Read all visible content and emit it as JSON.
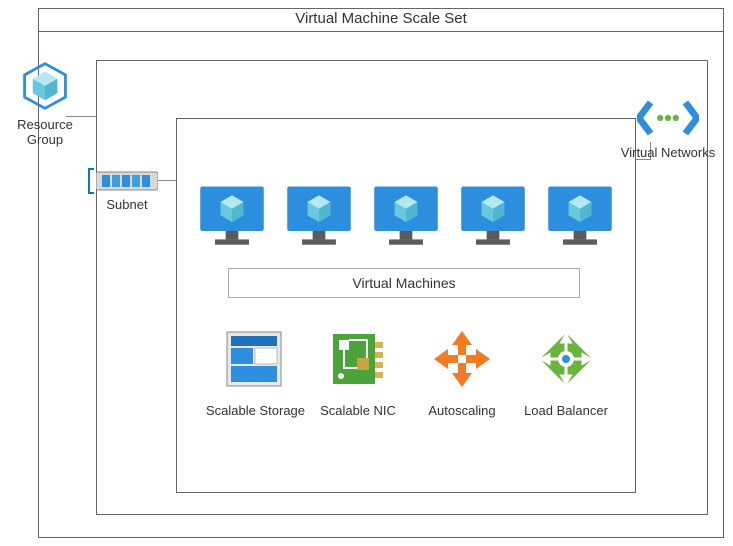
{
  "title": "Virtual Machine Scale Set",
  "resource_group": {
    "label": "Resource Group"
  },
  "virtual_networks": {
    "label": "Virtual Networks"
  },
  "subnet": {
    "label": "Subnet"
  },
  "vm_box": {
    "label": "Virtual Machines"
  },
  "features": {
    "storage": {
      "label": "Scalable Storage"
    },
    "nic": {
      "label": "Scalable NIC"
    },
    "autoscale": {
      "label": "Autoscaling"
    },
    "lb": {
      "label": "Load Balancer"
    }
  },
  "colors": {
    "azure_blue": "#2e8ede",
    "azure_dark": "#1f6bb0",
    "cube_light": "#67c8df",
    "orange": "#f37b21",
    "green_pcb": "#4aa43a",
    "green_lb": "#6bb33f"
  }
}
